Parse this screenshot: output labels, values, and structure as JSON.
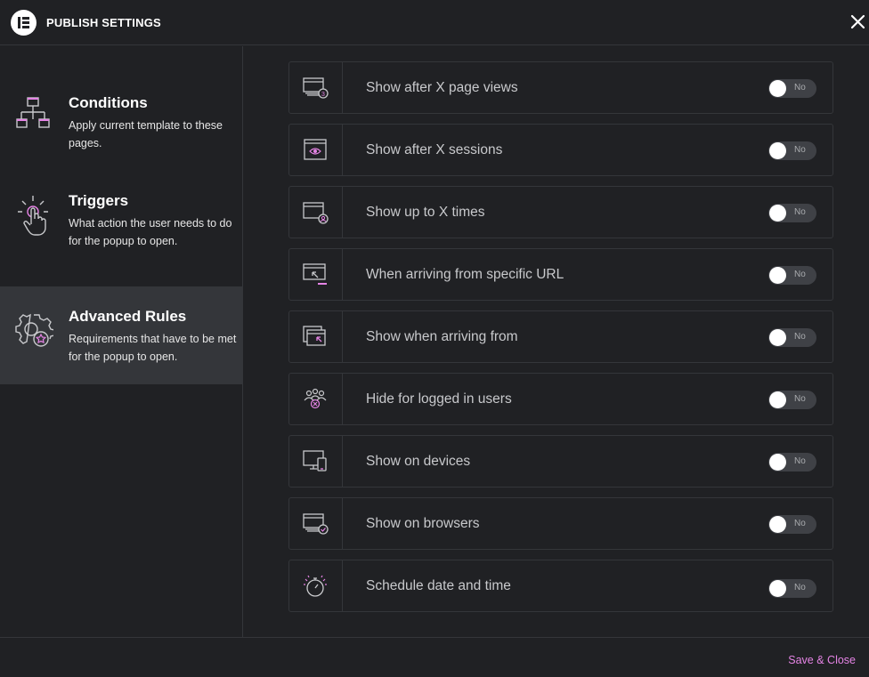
{
  "header": {
    "title": "PUBLISH SETTINGS"
  },
  "sidebar": {
    "items": [
      {
        "title": "Conditions",
        "desc": "Apply current template to these pages."
      },
      {
        "title": "Triggers",
        "desc": "What action the user needs to do for the popup to open."
      },
      {
        "title": "Advanced Rules",
        "desc": "Requirements that have to be met for the popup to open."
      }
    ]
  },
  "rules": [
    {
      "label": "Show after X page views",
      "toggle": "No",
      "icon": "page-views-icon"
    },
    {
      "label": "Show after X sessions",
      "toggle": "No",
      "icon": "sessions-icon"
    },
    {
      "label": "Show up to X times",
      "toggle": "No",
      "icon": "times-icon"
    },
    {
      "label": "When arriving from specific URL",
      "toggle": "No",
      "icon": "url-icon"
    },
    {
      "label": "Show when arriving from",
      "toggle": "No",
      "icon": "arriving-from-icon"
    },
    {
      "label": "Hide for logged in users",
      "toggle": "No",
      "icon": "logged-in-users-icon"
    },
    {
      "label": "Show on devices",
      "toggle": "No",
      "icon": "devices-icon"
    },
    {
      "label": "Show on browsers",
      "toggle": "No",
      "icon": "browsers-icon"
    },
    {
      "label": "Schedule date and time",
      "toggle": "No",
      "icon": "schedule-icon"
    }
  ],
  "footer": {
    "save_label": "Save & Close"
  },
  "colors": {
    "accent": "#e584e5",
    "background": "#202124",
    "active": "#34363a"
  }
}
